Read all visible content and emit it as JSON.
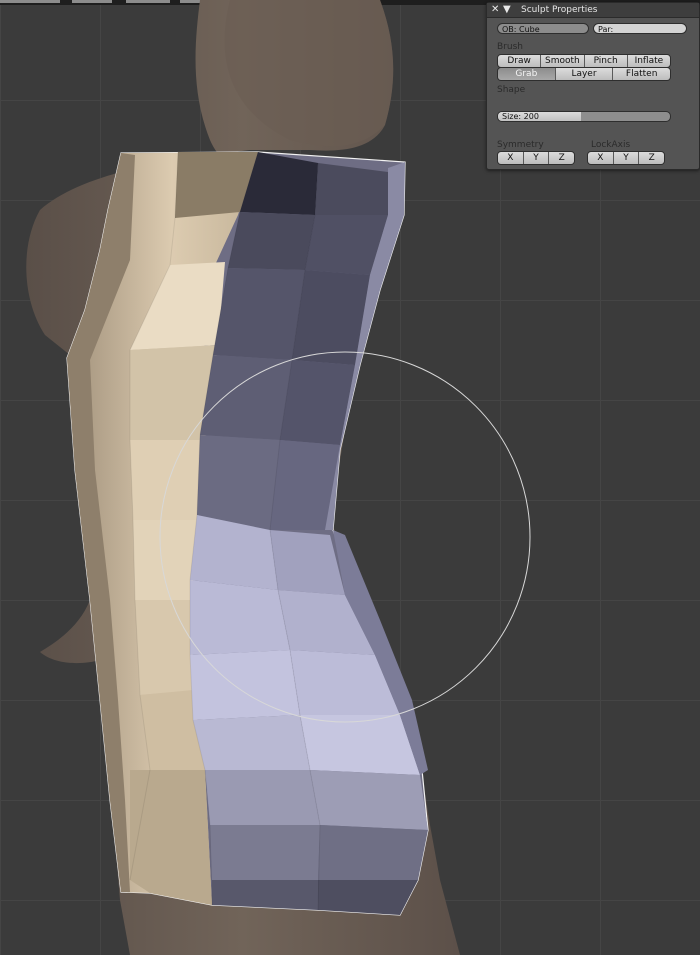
{
  "panel": {
    "title": "Sculpt Properties",
    "close_icon": "✕",
    "collapse_icon": "▼",
    "ob_field": "OB: Cube",
    "par_field": "Par:",
    "brush_label": "Brush",
    "brush_row1": [
      "Draw",
      "Smooth",
      "Pinch",
      "Inflate"
    ],
    "brush_row2": [
      "Grab",
      "Layer",
      "Flatten"
    ],
    "active_brush": "Grab",
    "shape_label": "Shape",
    "size_text": "Size: 200",
    "size_fraction": 0.48,
    "symmetry_label": "Symmetry",
    "lockaxis_label": "LockAxis",
    "symmetry_axes": [
      "X",
      "Y",
      "Z"
    ],
    "lockaxis_axes": [
      "X",
      "Y",
      "Z"
    ]
  },
  "viewport": {
    "grid_color": "#454545",
    "background_color": "#3b3b3b",
    "reference_figure_color": "#6f6258",
    "cage_light_tone": "#d9c8ad",
    "cage_dark_tone": "#45455a",
    "cage_bright_tone": "#b9b9d4"
  }
}
